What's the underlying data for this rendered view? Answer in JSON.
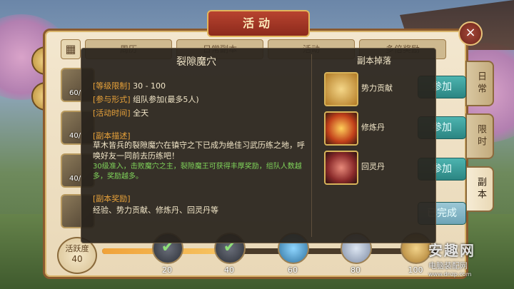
{
  "window": {
    "title": "活动",
    "close_icon": "×"
  },
  "top_tabs": [
    {
      "label": "周历"
    },
    {
      "label": "日常副本"
    },
    {
      "label": "活动"
    },
    {
      "label": "多倍奖励"
    }
  ],
  "side_tabs": [
    {
      "label": "日常",
      "active": false
    },
    {
      "label": "限时",
      "active": false
    },
    {
      "label": "副本",
      "active": true
    }
  ],
  "activity_rows": [
    {
      "count": "60/"
    },
    {
      "count": "40/"
    },
    {
      "count": "40/"
    },
    {
      "count": ""
    }
  ],
  "buttons": {
    "join_1": "参加",
    "join_2": "参加",
    "join_3": "参加",
    "done": "已完成"
  },
  "progress": {
    "label": "活跃度",
    "value": "40",
    "fill": 0.4,
    "milestones": [
      {
        "value": "20",
        "claimed": true
      },
      {
        "value": "40",
        "claimed": true
      },
      {
        "value": "60",
        "claimed": false
      },
      {
        "value": "80",
        "claimed": false
      },
      {
        "value": "100",
        "claimed": false
      }
    ]
  },
  "popup": {
    "title": "裂隙魔穴",
    "level_key": "[等级限制]",
    "level_val": "30 - 100",
    "form_key": "[参与形式]",
    "form_val": "组队参加(最多5人)",
    "time_key": "[活动时间]",
    "time_val": "全天",
    "desc_title": "[副本描述]",
    "desc_text": "草木皆兵的裂隙魔穴在镇守之下已成为绝佳习武历练之地，呼唤好友一同前去历练吧！",
    "desc_green": "30级准入，击败魔穴之主，裂隙魔王可获得丰厚奖励，组队人数越多，奖励越多。",
    "reward_title": "[副本奖励]",
    "reward_text": "经验、势力贡献、修炼丹、回灵丹等",
    "drop_title": "副本掉落",
    "drops": [
      {
        "name": "势力贡献",
        "icon": "scroll-token-icon",
        "color": "#c98a2a"
      },
      {
        "name": "修炼丹",
        "icon": "fire-pill-icon",
        "color": "#d0501e"
      },
      {
        "name": "回灵丹",
        "icon": "spirit-pill-icon",
        "color": "#8a2a2a"
      }
    ]
  },
  "watermark": {
    "logo": "安趣网",
    "site": "电脑装配网",
    "url": "www.dnzp.com"
  }
}
